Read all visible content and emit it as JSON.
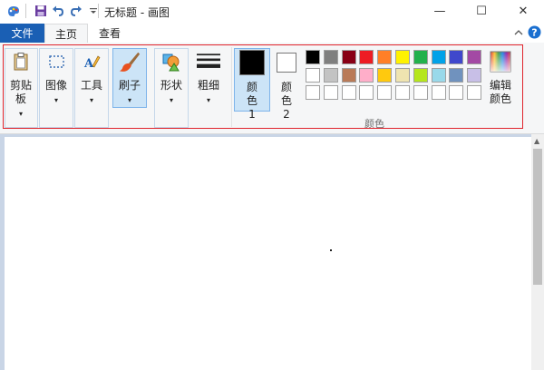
{
  "window": {
    "title": "无标题 - 画图",
    "minimize_glyph": "—",
    "maximize_glyph": "☐",
    "close_glyph": "✕"
  },
  "tabs": [
    {
      "label": "文件"
    },
    {
      "label": "主页"
    },
    {
      "label": "查看"
    }
  ],
  "tools": {
    "clipboard": "剪贴板",
    "image": "图像",
    "tools": "工具",
    "brushes": "刷子",
    "shapes": "形状",
    "size": "粗细",
    "color1": "颜色 1",
    "color2": "颜色 2",
    "edit_colors": "编辑颜色"
  },
  "colors_group_label": "颜色",
  "current_colors": {
    "color1": "#000000",
    "color2": "#ffffff"
  },
  "palette": {
    "row1": [
      "#000000",
      "#7f7f7f",
      "#880015",
      "#ed1c24",
      "#ff7f27",
      "#fff200",
      "#22b14c",
      "#00a2e8",
      "#3f48cc",
      "#a349a4"
    ],
    "row2": [
      "#ffffff",
      "#c3c3c3",
      "#b97a57",
      "#ffaec9",
      "#ffc90e",
      "#efe4b0",
      "#b5e61d",
      "#99d9ea",
      "#7092be",
      "#c8bfe7"
    ],
    "row3": [
      "#ffffff",
      "#ffffff",
      "#ffffff",
      "#ffffff",
      "#ffffff",
      "#ffffff",
      "#ffffff",
      "#ffffff",
      "#ffffff",
      "#ffffff"
    ]
  }
}
